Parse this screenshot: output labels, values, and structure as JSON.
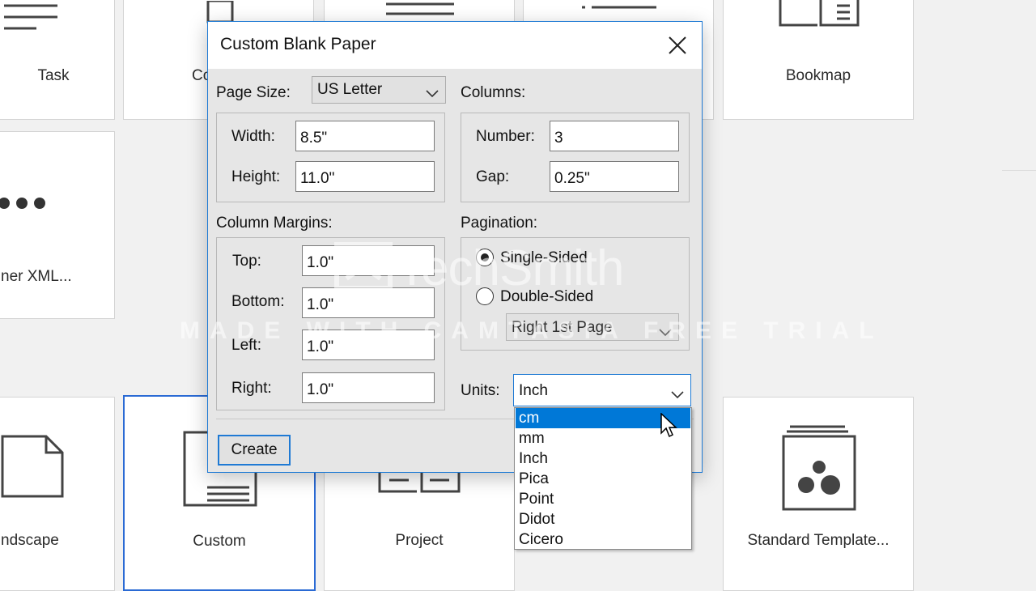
{
  "background_tiles": [
    {
      "label": "Task"
    },
    {
      "label": "Co"
    },
    {
      "label": ""
    },
    {
      "label": ""
    },
    {
      "label": "Bookmap"
    },
    {
      "label": "ner XML..."
    },
    {
      "label": "ndscape"
    },
    {
      "label": "Custom"
    },
    {
      "label": "Project"
    },
    {
      "label": "Standard Template..."
    }
  ],
  "dialog": {
    "title": "Custom Blank Paper",
    "page_size": {
      "label": "Page Size:",
      "value": "US Letter"
    },
    "width": {
      "label": "Width:",
      "value": "8.5\""
    },
    "height": {
      "label": "Height:",
      "value": "11.0\""
    },
    "columns": {
      "label": "Columns:",
      "number_label": "Number:",
      "number_value": "3",
      "gap_label": "Gap:",
      "gap_value": "0.25\""
    },
    "margins": {
      "label": "Column Margins:",
      "top_label": "Top:",
      "top_value": "1.0\"",
      "bottom_label": "Bottom:",
      "bottom_value": "1.0\"",
      "left_label": "Left:",
      "left_value": "1.0\"",
      "right_label": "Right:",
      "right_value": "1.0\""
    },
    "pagination": {
      "label": "Pagination:",
      "single_sided": "Single-Sided",
      "double_sided": "Double-Sided",
      "selected": "Single-Sided",
      "first_page": "Right 1st Page"
    },
    "units": {
      "label": "Units:",
      "value": "Inch",
      "options": [
        "cm",
        "mm",
        "Inch",
        "Pica",
        "Point",
        "Didot",
        "Cicero"
      ],
      "highlighted": "cm"
    },
    "create_label": "Create"
  },
  "watermark": {
    "brand": "TechSmith",
    "text": "MADE WITH CAMTASIA FREE TRIAL"
  },
  "colors": {
    "accent": "#0078d7",
    "dialog_bg": "#e6e6e6",
    "selection_border": "#2a6ad4"
  }
}
